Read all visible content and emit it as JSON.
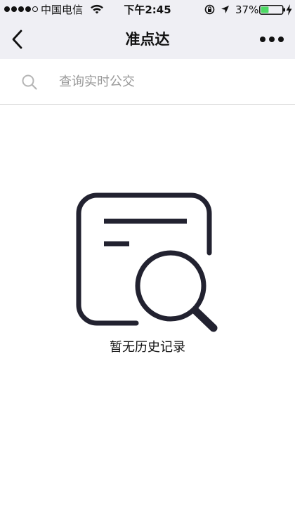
{
  "status_bar": {
    "carrier": "中国电信",
    "time": "下午2:45",
    "battery_percent": "37%",
    "battery_level": 0.37,
    "battery_color": "#4cd964",
    "signal_bars_filled": 4,
    "signal_bars_total": 5
  },
  "nav": {
    "title": "准点达",
    "back_icon": "chevron-left-icon",
    "more_icon": "more-dots-icon"
  },
  "search": {
    "placeholder": "查询实时公交",
    "icon": "search-icon"
  },
  "empty_state": {
    "icon": "history-search-icon",
    "message": "暂无历史记录"
  },
  "colors": {
    "header_background": "#efeff4",
    "placeholder_text": "#999999",
    "illustration_stroke": "#222230"
  }
}
